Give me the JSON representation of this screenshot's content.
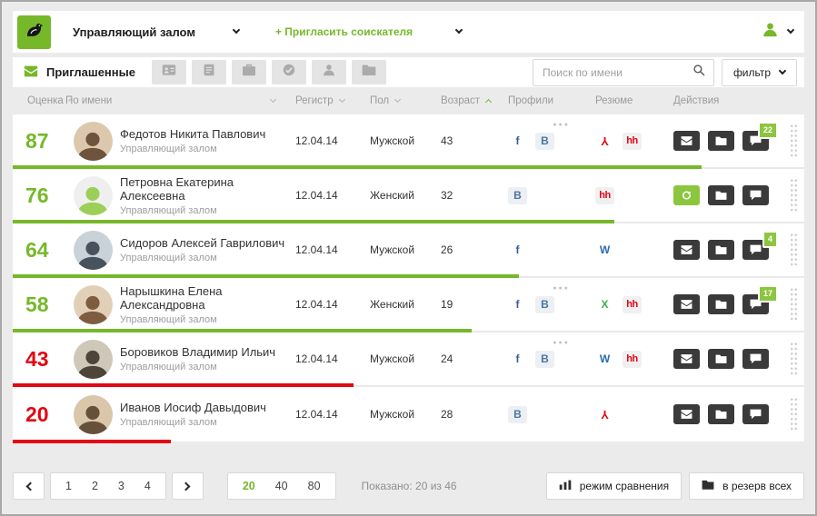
{
  "colors": {
    "green": "#76b82a",
    "green_light": "#8cc63f",
    "red": "#e30613",
    "dark": "#3a3a3a"
  },
  "header": {
    "vacancy": "Управляющий залом",
    "invite": "+ Пригласить соискателя"
  },
  "toolbar": {
    "active_tab": "Приглашенные",
    "tab_icons": [
      "id-card",
      "document",
      "briefcase",
      "check",
      "person",
      "folder"
    ],
    "search_placeholder": "Поиск по имени",
    "filter": "фильтр"
  },
  "columns": {
    "score": "Оценка",
    "name": "По имени",
    "date": "Регистр",
    "gender": "Пол",
    "age": "Возраст",
    "profiles": "Профили",
    "resume": "Резюме",
    "actions": "Действия"
  },
  "rows": [
    {
      "score": "87",
      "tone": "green",
      "name": "Федотов Никита Павлович",
      "position": "Управляющий залом",
      "date": "12.04.14",
      "gender": "Мужской",
      "age": "43",
      "avatar": "photo",
      "profiles": [
        "fb",
        "vk"
      ],
      "profiles_more": true,
      "resume": [
        "pdf",
        "hh"
      ],
      "actions": [
        {
          "icon": "mail"
        },
        {
          "icon": "folder"
        },
        {
          "icon": "chat",
          "badge": "22"
        }
      ]
    },
    {
      "score": "76",
      "tone": "green",
      "name": "Петровна Екатерина Алексеевна",
      "position": "Управляющий залом",
      "date": "12.04.14",
      "gender": "Женский",
      "age": "32",
      "avatar": "placeholder",
      "profiles": [
        "vk"
      ],
      "profiles_more": false,
      "resume": [
        "hh"
      ],
      "actions": [
        {
          "icon": "refresh",
          "style": "green"
        },
        {
          "icon": "folder"
        },
        {
          "icon": "chat"
        }
      ]
    },
    {
      "score": "64",
      "tone": "green",
      "name": "Сидоров Алексей Гаврилович",
      "position": "Управляющий залом",
      "date": "12.04.14",
      "gender": "Мужской",
      "age": "26",
      "avatar": "photo",
      "profiles": [
        "fb"
      ],
      "profiles_more": false,
      "resume": [
        "word"
      ],
      "actions": [
        {
          "icon": "mail"
        },
        {
          "icon": "folder"
        },
        {
          "icon": "chat",
          "badge": "4"
        }
      ]
    },
    {
      "score": "58",
      "tone": "green",
      "name": "Нарышкина Елена Александровна",
      "position": "Управляющий залом",
      "date": "12.04.14",
      "gender": "Женский",
      "age": "19",
      "avatar": "photo",
      "profiles": [
        "fb",
        "vk"
      ],
      "profiles_more": true,
      "resume": [
        "excel",
        "hh"
      ],
      "actions": [
        {
          "icon": "mail"
        },
        {
          "icon": "folder"
        },
        {
          "icon": "chat",
          "badge": "17"
        }
      ]
    },
    {
      "score": "43",
      "tone": "red",
      "name": "Боровиков Владимир Ильич",
      "position": "Управляющий залом",
      "date": "12.04.14",
      "gender": "Мужской",
      "age": "24",
      "avatar": "photo",
      "profiles": [
        "fb",
        "vk"
      ],
      "profiles_more": true,
      "resume": [
        "word",
        "hh"
      ],
      "actions": [
        {
          "icon": "mail"
        },
        {
          "icon": "folder"
        },
        {
          "icon": "chat"
        }
      ]
    },
    {
      "score": "20",
      "tone": "red",
      "name": "Иванов Иосиф Давыдович",
      "position": "Управляющий залом",
      "date": "12.04.14",
      "gender": "Мужской",
      "age": "28",
      "avatar": "photo",
      "profiles": [
        "vk"
      ],
      "profiles_more": false,
      "resume": [
        "pdf"
      ],
      "actions": [
        {
          "icon": "mail"
        },
        {
          "icon": "folder"
        },
        {
          "icon": "chat"
        }
      ]
    }
  ],
  "footer": {
    "pages": [
      "1",
      "2",
      "3",
      "4"
    ],
    "page_sizes": [
      "20",
      "40",
      "80"
    ],
    "active_page_size": "20",
    "shown": "Показано: 20 из 46",
    "compare": "режим сравнения",
    "reserve": "в резерв всех"
  }
}
